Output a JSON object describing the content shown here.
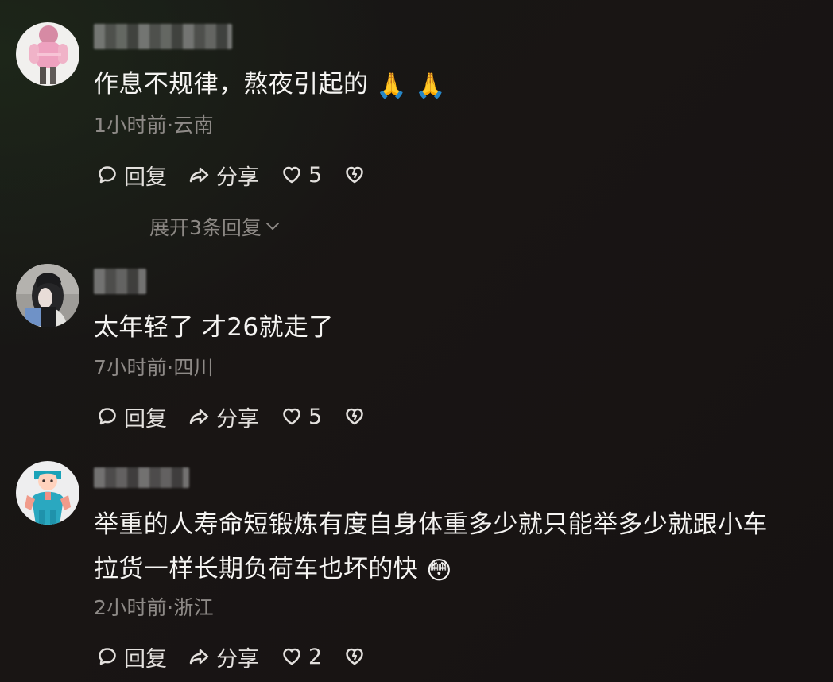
{
  "comments": [
    {
      "text": "作息不规律，熬夜引起的",
      "emojis": [
        "🙏",
        "🙏"
      ],
      "meta": "1小时前·云南",
      "actions": {
        "reply": "回复",
        "share": "分享",
        "likes": "5"
      },
      "expand_replies": "展开3条回复"
    },
    {
      "text": "太年轻了 才26就走了",
      "meta": "7小时前·四川",
      "actions": {
        "reply": "回复",
        "share": "分享",
        "likes": "5"
      }
    },
    {
      "text_line1": "举重的人寿命短锻炼有度自身体重多少就只能举多少就跟小车",
      "text_line2": "拉货一样长期负荷车也坏的快",
      "emoji": "😳",
      "meta": "2小时前·浙江",
      "actions": {
        "reply": "回复",
        "share": "分享",
        "likes": "2"
      }
    }
  ],
  "icons": {
    "reply": "comment-bubble-icon",
    "share": "share-arrow-icon",
    "like": "heart-icon",
    "dislike": "broken-heart-icon",
    "expand": "chevron-down-icon"
  },
  "colors": {
    "background": "#171514",
    "primary_text": "#f5f4f2",
    "secondary_text": "#8e8a87",
    "action_text": "#e3e0dd"
  }
}
